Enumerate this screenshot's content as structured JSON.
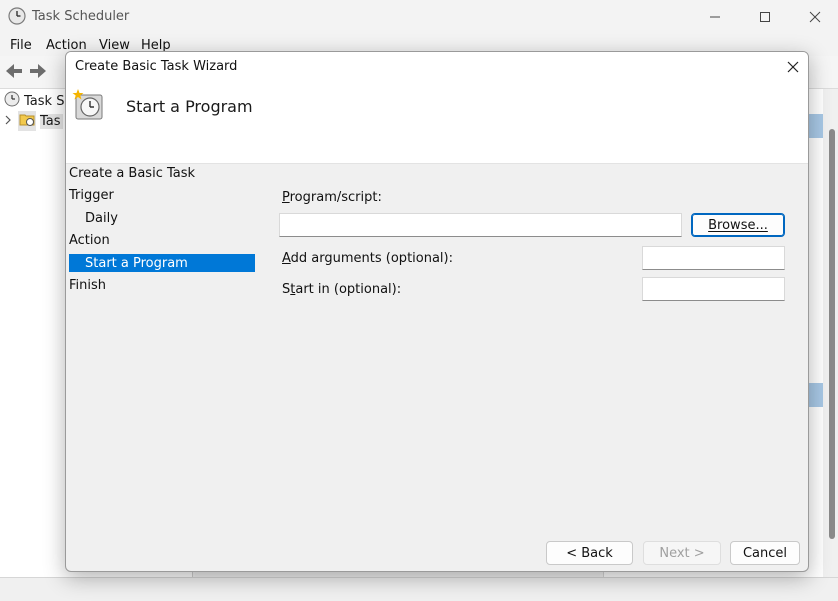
{
  "app": {
    "title": "Task Scheduler",
    "menu": [
      "File",
      "Action",
      "View",
      "Help"
    ],
    "tree": [
      {
        "label": "Task Sc"
      },
      {
        "label": "Tas"
      }
    ]
  },
  "dialog": {
    "title": "Create Basic Task Wizard",
    "header_title": "Start a Program",
    "steps": [
      {
        "label": "Create a Basic Task"
      },
      {
        "label": "Trigger"
      },
      {
        "label": "Daily"
      },
      {
        "label": "Action"
      },
      {
        "label": "Start a Program"
      },
      {
        "label": "Finish"
      }
    ],
    "program_label_accel": "P",
    "program_label_rest": "rogram/script:",
    "program_value": "",
    "browse_accel": "R",
    "browse_label": "Browse...",
    "args_accel": "A",
    "args_label_rest": "dd arguments (optional):",
    "args_value": "",
    "startin_accel": "t",
    "startin_label_pre": "S",
    "startin_label_rest": "art in (optional):",
    "startin_value": "",
    "back_label": "< Back",
    "next_label": "Next >",
    "cancel_label": "Cancel"
  },
  "colors": {
    "selection": "#0078d7",
    "default_button_border": "#0067c0"
  }
}
